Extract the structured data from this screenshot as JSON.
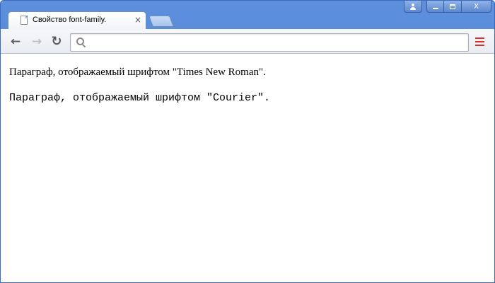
{
  "window": {
    "tab_title": "Свойство font-family.",
    "tab_close_glyph": "×",
    "frame_color": "#4a7fd3"
  },
  "caption_buttons": {
    "user_icon": "user-icon",
    "minimize_icon": "minimize-icon",
    "maximize_icon": "maximize-icon",
    "close_glyph": "X"
  },
  "toolbar": {
    "back_glyph": "←",
    "forward_glyph": "→",
    "reload_glyph": "↻",
    "address_value": "",
    "menu_color": "#d9302c"
  },
  "content": {
    "paragraph_serif": "Параграф, отображаемый шрифтом \"Times New Roman\".",
    "paragraph_mono": "Параграф, отображаемый шрифтом \"Courier\"."
  }
}
